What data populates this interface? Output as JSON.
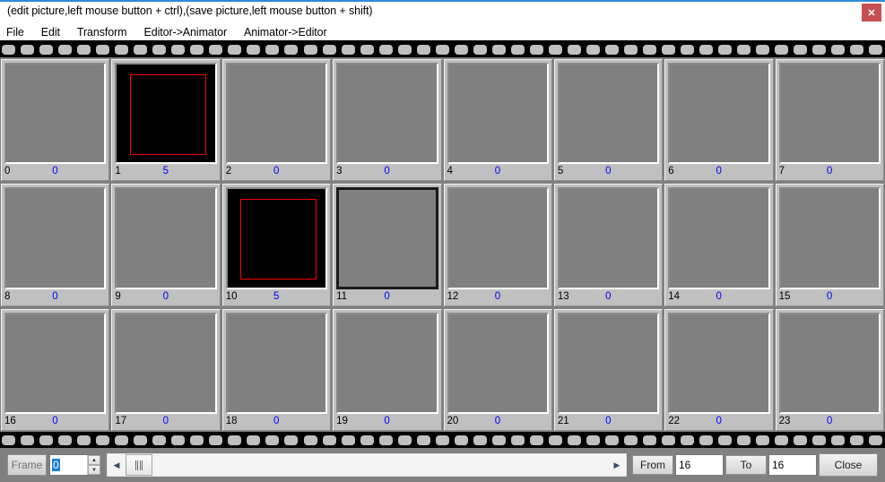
{
  "window": {
    "title": "(edit picture,left mouse button + ctrl),(save picture,left mouse button + shift)",
    "close_label": "✕",
    "accent_color": "#2e8ad6",
    "close_color": "#c75050"
  },
  "menubar": {
    "items": [
      {
        "label": "File"
      },
      {
        "label": "Edit"
      },
      {
        "label": "Transform"
      },
      {
        "label": "Editor->Animator"
      },
      {
        "label": "Animator->Editor"
      }
    ]
  },
  "filmstrip": {
    "perforation_count": 47,
    "canvas_empty_color": "#808080",
    "canvas_drawn_color": "#000000",
    "shape_color": "#ff0000",
    "value_color": "#0000ff",
    "columns": 8,
    "rows": 3,
    "frames": [
      {
        "index": "0",
        "value": "0",
        "drawn": false,
        "selected": false
      },
      {
        "index": "1",
        "value": "5",
        "drawn": true,
        "selected": false
      },
      {
        "index": "2",
        "value": "0",
        "drawn": false,
        "selected": false
      },
      {
        "index": "3",
        "value": "0",
        "drawn": false,
        "selected": false
      },
      {
        "index": "4",
        "value": "0",
        "drawn": false,
        "selected": false
      },
      {
        "index": "5",
        "value": "0",
        "drawn": false,
        "selected": false
      },
      {
        "index": "6",
        "value": "0",
        "drawn": false,
        "selected": false
      },
      {
        "index": "7",
        "value": "0",
        "drawn": false,
        "selected": false
      },
      {
        "index": "8",
        "value": "0",
        "drawn": false,
        "selected": false
      },
      {
        "index": "9",
        "value": "0",
        "drawn": false,
        "selected": false
      },
      {
        "index": "10",
        "value": "5",
        "drawn": true,
        "selected": false
      },
      {
        "index": "11",
        "value": "0",
        "drawn": false,
        "selected": true
      },
      {
        "index": "12",
        "value": "0",
        "drawn": false,
        "selected": false
      },
      {
        "index": "13",
        "value": "0",
        "drawn": false,
        "selected": false
      },
      {
        "index": "14",
        "value": "0",
        "drawn": false,
        "selected": false
      },
      {
        "index": "15",
        "value": "0",
        "drawn": false,
        "selected": false
      },
      {
        "index": "16",
        "value": "0",
        "drawn": false,
        "selected": false
      },
      {
        "index": "17",
        "value": "0",
        "drawn": false,
        "selected": false
      },
      {
        "index": "18",
        "value": "0",
        "drawn": false,
        "selected": false
      },
      {
        "index": "19",
        "value": "0",
        "drawn": false,
        "selected": false
      },
      {
        "index": "20",
        "value": "0",
        "drawn": false,
        "selected": false
      },
      {
        "index": "21",
        "value": "0",
        "drawn": false,
        "selected": false
      },
      {
        "index": "22",
        "value": "0",
        "drawn": false,
        "selected": false
      },
      {
        "index": "23",
        "value": "0",
        "drawn": false,
        "selected": false
      }
    ]
  },
  "toolbar": {
    "frame_label": "Frame",
    "frame_value": "0",
    "spin_up": "▲",
    "spin_down": "▼",
    "scroll_left": "◀",
    "scroll_right": "▶",
    "from_label": "From",
    "from_value": "16",
    "to_label": "To",
    "to_value": "16",
    "close_label": "Close"
  }
}
